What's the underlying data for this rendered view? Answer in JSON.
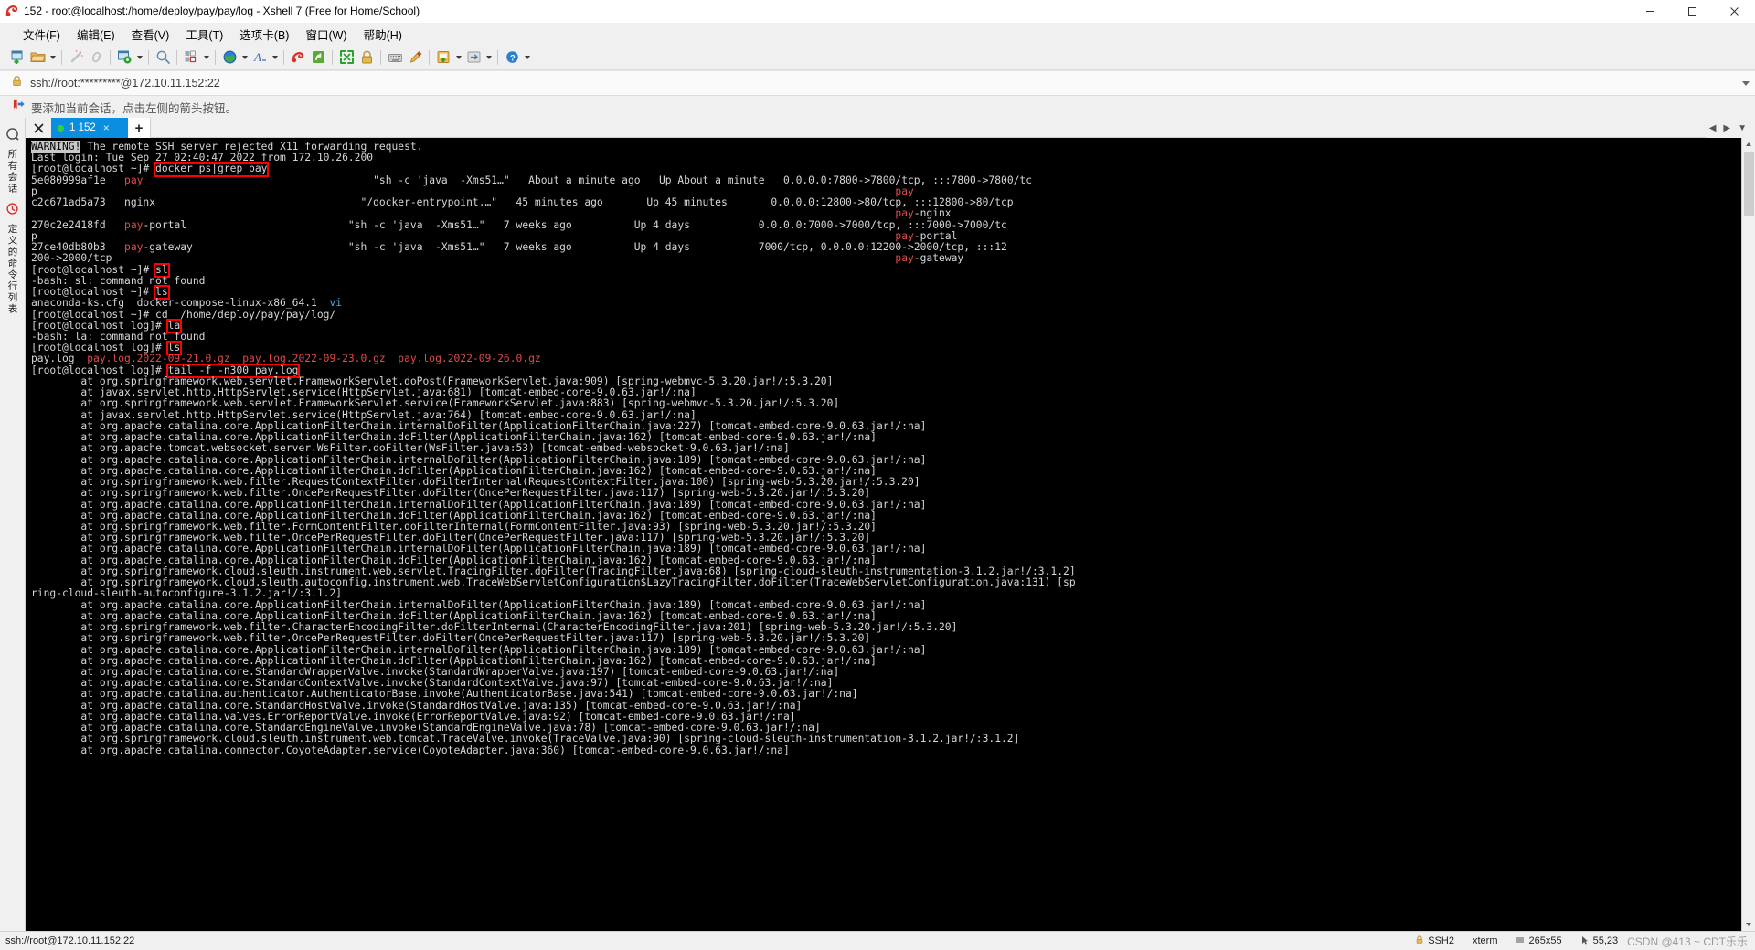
{
  "window": {
    "title": "152 - root@localhost:/home/deploy/pay/pay/log - Xshell 7 (Free for Home/School)",
    "minimize_label": "–",
    "maximize_label": "☐",
    "close_label": "✕"
  },
  "menubar": {
    "items": [
      {
        "label": "文件(F)",
        "name": "menu-file"
      },
      {
        "label": "编辑(E)",
        "name": "menu-edit"
      },
      {
        "label": "查看(V)",
        "name": "menu-view"
      },
      {
        "label": "工具(T)",
        "name": "menu-tools"
      },
      {
        "label": "选项卡(B)",
        "name": "menu-tabs"
      },
      {
        "label": "窗口(W)",
        "name": "menu-window"
      },
      {
        "label": "帮助(H)",
        "name": "menu-help"
      }
    ]
  },
  "toolbar": {
    "icons": [
      "new-session-icon",
      "open-folder-icon",
      "folder-dropdown-caret",
      "disconnect-icon",
      "link-icon",
      "session-properties-icon",
      "properties-dropdown-caret",
      "find-icon",
      "layout-icon",
      "layout-dropdown-caret",
      "globe-icon",
      "globe-dropdown-caret",
      "font-icon",
      "font-dropdown-caret",
      "log-icon",
      "compose-icon",
      "fullscreen-icon",
      "lock-icon",
      "keyboard-icon",
      "highlight-icon",
      "add-note-icon",
      "note-dropdown-caret",
      "transfer-icon",
      "transfer-dropdown-caret",
      "help-icon",
      "help-dropdown-caret"
    ]
  },
  "address_bar": {
    "lock_icon": "lock-icon",
    "url": "ssh://root:*********@172.10.11.152:22",
    "dropdown_icon": "chevron-down-icon"
  },
  "notice_bar": {
    "icon": "arrow-bookmark-icon",
    "text": "要添加当前会话，点击左侧的箭头按钮。"
  },
  "sidebar": {
    "title": "所有会话",
    "icons": [
      "session-manager-icon",
      "history-icon"
    ],
    "vertical_labels": [
      "定义的命令行列表"
    ]
  },
  "tabs": {
    "close_icon": "close-all-tabs-icon",
    "items": [
      {
        "index": "1",
        "label": "152",
        "status_dot_color": "#31d043",
        "close_icon": "tab-close-icon"
      }
    ],
    "new_tab_label": "+",
    "nav_left": "◀",
    "nav_right": "▶",
    "nav_menu": "▼"
  },
  "terminal": {
    "lines": [
      [
        {
          "t": "WARNING!",
          "c": "inv"
        },
        {
          "t": " The remote SSH server rejected X11 forwarding request."
        }
      ],
      [
        {
          "t": "Last login: Tue Sep 27 02:40:47 2022 from 172.10.26.200"
        }
      ],
      [
        {
          "t": "[root@localhost ~]# "
        },
        {
          "t": "docker ps|grep pay",
          "c": "box"
        }
      ],
      [
        {
          "t": "5e080999af1e   "
        },
        {
          "t": "pay",
          "c": "red"
        },
        {
          "t": "                                     \"sh -c 'java  -Xms51…\"   About a minute ago   Up About a minute   0.0.0.0:7800->7800/tcp, :::7800->7800/tc"
        }
      ],
      [
        {
          "t": "p                                                                                                                                          "
        },
        {
          "t": "pay",
          "c": "red"
        }
      ],
      [
        {
          "t": "c2c671ad5a73   nginx                                 \"/docker-entrypoint.…\"   45 minutes ago       Up 45 minutes       0.0.0.0:12800->80/tcp, :::12800->80/tcp"
        }
      ],
      [
        {
          "t": "                                                                                                                                           "
        },
        {
          "t": "pay",
          "c": "red"
        },
        {
          "t": "-nginx"
        }
      ],
      [
        {
          "t": "270c2e2418fd   "
        },
        {
          "t": "pay",
          "c": "red"
        },
        {
          "t": "-portal                          \"sh -c 'java  -Xms51…\"   7 weeks ago          Up 4 days           0.0.0.0:7000->7000/tcp, :::7000->7000/tc"
        }
      ],
      [
        {
          "t": "p                                                                                                                                          "
        },
        {
          "t": "pay",
          "c": "red"
        },
        {
          "t": "-portal"
        }
      ],
      [
        {
          "t": "27ce40db80b3   "
        },
        {
          "t": "pay",
          "c": "red"
        },
        {
          "t": "-gateway                         \"sh -c 'java  -Xms51…\"   7 weeks ago          Up 4 days           7000/tcp, 0.0.0.0:12200->2000/tcp, :::12"
        }
      ],
      [
        {
          "t": "200->2000/tcp                                                                                                                              "
        },
        {
          "t": "pay",
          "c": "red"
        },
        {
          "t": "-gateway"
        }
      ],
      [
        {
          "t": "[root@localhost ~]# "
        },
        {
          "t": "sl",
          "c": "box"
        }
      ],
      [
        {
          "t": "-bash: sl: command not found"
        }
      ],
      [
        {
          "t": "[root@localhost ~]# "
        },
        {
          "t": "ls",
          "c": "box"
        }
      ],
      [
        {
          "t": "anaconda-ks.cfg  docker-compose-linux-x86_64.1  "
        },
        {
          "t": "vi",
          "c": "blue"
        }
      ],
      [
        {
          "t": "[root@localhost ~]# cd  /home/deploy/pay/pay/log/"
        }
      ],
      [
        {
          "t": "[root@localhost log]# "
        },
        {
          "t": "la",
          "c": "box"
        }
      ],
      [
        {
          "t": "-bash: la: command not found"
        }
      ],
      [
        {
          "t": "[root@localhost log]# "
        },
        {
          "t": "ls",
          "c": "box"
        }
      ],
      [
        {
          "t": "pay.log  "
        },
        {
          "t": "pay.log.2022-09-21.0.gz  pay.log.2022-09-23.0.gz  pay.log.2022-09-26.0.gz",
          "c": "red"
        }
      ],
      [
        {
          "t": "[root@localhost log]# "
        },
        {
          "t": "tail -f -n300 pay.log",
          "c": "box"
        }
      ],
      [
        {
          "t": "        at org.springframework.web.servlet.FrameworkServlet.doPost(FrameworkServlet.java:909) [spring-webmvc-5.3.20.jar!/:5.3.20]"
        }
      ],
      [
        {
          "t": "        at javax.servlet.http.HttpServlet.service(HttpServlet.java:681) [tomcat-embed-core-9.0.63.jar!/:na]"
        }
      ],
      [
        {
          "t": "        at org.springframework.web.servlet.FrameworkServlet.service(FrameworkServlet.java:883) [spring-webmvc-5.3.20.jar!/:5.3.20]"
        }
      ],
      [
        {
          "t": "        at javax.servlet.http.HttpServlet.service(HttpServlet.java:764) [tomcat-embed-core-9.0.63.jar!/:na]"
        }
      ],
      [
        {
          "t": "        at org.apache.catalina.core.ApplicationFilterChain.internalDoFilter(ApplicationFilterChain.java:227) [tomcat-embed-core-9.0.63.jar!/:na]"
        }
      ],
      [
        {
          "t": "        at org.apache.catalina.core.ApplicationFilterChain.doFilter(ApplicationFilterChain.java:162) [tomcat-embed-core-9.0.63.jar!/:na]"
        }
      ],
      [
        {
          "t": "        at org.apache.tomcat.websocket.server.WsFilter.doFilter(WsFilter.java:53) [tomcat-embed-websocket-9.0.63.jar!/:na]"
        }
      ],
      [
        {
          "t": "        at org.apache.catalina.core.ApplicationFilterChain.internalDoFilter(ApplicationFilterChain.java:189) [tomcat-embed-core-9.0.63.jar!/:na]"
        }
      ],
      [
        {
          "t": "        at org.apache.catalina.core.ApplicationFilterChain.doFilter(ApplicationFilterChain.java:162) [tomcat-embed-core-9.0.63.jar!/:na]"
        }
      ],
      [
        {
          "t": "        at org.springframework.web.filter.RequestContextFilter.doFilterInternal(RequestContextFilter.java:100) [spring-web-5.3.20.jar!/:5.3.20]"
        }
      ],
      [
        {
          "t": "        at org.springframework.web.filter.OncePerRequestFilter.doFilter(OncePerRequestFilter.java:117) [spring-web-5.3.20.jar!/:5.3.20]"
        }
      ],
      [
        {
          "t": "        at org.apache.catalina.core.ApplicationFilterChain.internalDoFilter(ApplicationFilterChain.java:189) [tomcat-embed-core-9.0.63.jar!/:na]"
        }
      ],
      [
        {
          "t": "        at org.apache.catalina.core.ApplicationFilterChain.doFilter(ApplicationFilterChain.java:162) [tomcat-embed-core-9.0.63.jar!/:na]"
        }
      ],
      [
        {
          "t": "        at org.springframework.web.filter.FormContentFilter.doFilterInternal(FormContentFilter.java:93) [spring-web-5.3.20.jar!/:5.3.20]"
        }
      ],
      [
        {
          "t": "        at org.springframework.web.filter.OncePerRequestFilter.doFilter(OncePerRequestFilter.java:117) [spring-web-5.3.20.jar!/:5.3.20]"
        }
      ],
      [
        {
          "t": "        at org.apache.catalina.core.ApplicationFilterChain.internalDoFilter(ApplicationFilterChain.java:189) [tomcat-embed-core-9.0.63.jar!/:na]"
        }
      ],
      [
        {
          "t": "        at org.apache.catalina.core.ApplicationFilterChain.doFilter(ApplicationFilterChain.java:162) [tomcat-embed-core-9.0.63.jar!/:na]"
        }
      ],
      [
        {
          "t": "        at org.springframework.cloud.sleuth.instrument.web.servlet.TracingFilter.doFilter(TracingFilter.java:68) [spring-cloud-sleuth-instrumentation-3.1.2.jar!/:3.1.2]"
        }
      ],
      [
        {
          "t": "        at org.springframework.cloud.sleuth.autoconfig.instrument.web.TraceWebServletConfiguration$LazyTracingFilter.doFilter(TraceWebServletConfiguration.java:131) [sp"
        }
      ],
      [
        {
          "t": "ring-cloud-sleuth-autoconfigure-3.1.2.jar!/:3.1.2]"
        }
      ],
      [
        {
          "t": "        at org.apache.catalina.core.ApplicationFilterChain.internalDoFilter(ApplicationFilterChain.java:189) [tomcat-embed-core-9.0.63.jar!/:na]"
        }
      ],
      [
        {
          "t": "        at org.apache.catalina.core.ApplicationFilterChain.doFilter(ApplicationFilterChain.java:162) [tomcat-embed-core-9.0.63.jar!/:na]"
        }
      ],
      [
        {
          "t": "        at org.springframework.web.filter.CharacterEncodingFilter.doFilterInternal(CharacterEncodingFilter.java:201) [spring-web-5.3.20.jar!/:5.3.20]"
        }
      ],
      [
        {
          "t": "        at org.springframework.web.filter.OncePerRequestFilter.doFilter(OncePerRequestFilter.java:117) [spring-web-5.3.20.jar!/:5.3.20]"
        }
      ],
      [
        {
          "t": "        at org.apache.catalina.core.ApplicationFilterChain.internalDoFilter(ApplicationFilterChain.java:189) [tomcat-embed-core-9.0.63.jar!/:na]"
        }
      ],
      [
        {
          "t": "        at org.apache.catalina.core.ApplicationFilterChain.doFilter(ApplicationFilterChain.java:162) [tomcat-embed-core-9.0.63.jar!/:na]"
        }
      ],
      [
        {
          "t": "        at org.apache.catalina.core.StandardWrapperValve.invoke(StandardWrapperValve.java:197) [tomcat-embed-core-9.0.63.jar!/:na]"
        }
      ],
      [
        {
          "t": "        at org.apache.catalina.core.StandardContextValve.invoke(StandardContextValve.java:97) [tomcat-embed-core-9.0.63.jar!/:na]"
        }
      ],
      [
        {
          "t": "        at org.apache.catalina.authenticator.AuthenticatorBase.invoke(AuthenticatorBase.java:541) [tomcat-embed-core-9.0.63.jar!/:na]"
        }
      ],
      [
        {
          "t": "        at org.apache.catalina.core.StandardHostValve.invoke(StandardHostValve.java:135) [tomcat-embed-core-9.0.63.jar!/:na]"
        }
      ],
      [
        {
          "t": "        at org.apache.catalina.valves.ErrorReportValve.invoke(ErrorReportValve.java:92) [tomcat-embed-core-9.0.63.jar!/:na]"
        }
      ],
      [
        {
          "t": "        at org.apache.catalina.core.StandardEngineValve.invoke(StandardEngineValve.java:78) [tomcat-embed-core-9.0.63.jar!/:na]"
        }
      ],
      [
        {
          "t": "        at org.springframework.cloud.sleuth.instrument.web.tomcat.TraceValve.invoke(TraceValve.java:90) [spring-cloud-sleuth-instrumentation-3.1.2.jar!/:3.1.2]"
        }
      ],
      [
        {
          "t": "        at org.apache.catalina.connector.CoyoteAdapter.service(CoyoteAdapter.java:360) [tomcat-embed-core-9.0.63.jar!/:na]"
        }
      ]
    ]
  },
  "statusbar": {
    "connection": "ssh://root@172.10.11.152:22",
    "protocol_icon": "lock-icon",
    "protocol": "SSH2",
    "terminal_type": "xterm",
    "size_icon": "resize-icon",
    "size": "265x55",
    "cursor_icon": "cursor-icon",
    "cursor": "55,23",
    "watermark": "CSDN @413 ~ CDT乐乐"
  },
  "colors": {
    "accent": "#0a8fe0",
    "terminal_bg": "#000000",
    "terminal_fg": "#d6d6d6",
    "terminal_red": "#e04b4b",
    "highlight_box": "#fe0000",
    "tab_dot": "#31d043"
  }
}
